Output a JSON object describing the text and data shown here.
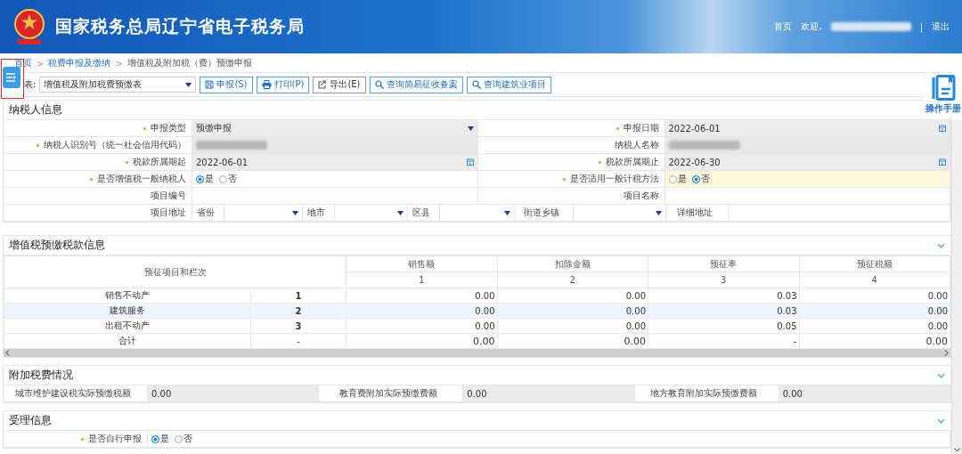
{
  "header": {
    "title": "国家税务总局辽宁省电子税务局",
    "home": "首页",
    "welcome": "欢迎,",
    "separator": "|",
    "logout": "退出"
  },
  "breadcrumb": {
    "separator": ">",
    "items": [
      {
        "label": "首页",
        "link": true
      },
      {
        "label": "税费申报及缴纳",
        "link": true
      },
      {
        "label": "增值税及附加税（费）预缴申报",
        "link": false
      }
    ]
  },
  "toolbar": {
    "report_label": "表:",
    "report_select": "增值税及附加税费预缴表",
    "buttons": [
      {
        "label": "申报(S)",
        "kind": "save"
      },
      {
        "label": "打印(P)",
        "kind": "print"
      },
      {
        "label": "导出(E)",
        "kind": "export"
      },
      {
        "label": "查询简易征收备案",
        "kind": "search"
      },
      {
        "label": "查询建筑业项目",
        "kind": "search"
      }
    ]
  },
  "help": {
    "label": "操作手册"
  },
  "taxpayer": {
    "title": "纳税人信息",
    "fields": [
      {
        "label": "申报类型",
        "required": true,
        "kind": "select",
        "value": "预缴申报"
      },
      {
        "label": "申报日期",
        "required": true,
        "kind": "date",
        "value": "2022-06-01"
      },
      {
        "label": "纳税人识别号（统一社会信用代码）",
        "required": true,
        "kind": "redacted"
      },
      {
        "label": "纳税人名称",
        "required": false,
        "kind": "redacted"
      },
      {
        "label": "税款所属期起",
        "required": true,
        "kind": "date",
        "value": "2022-06-01"
      },
      {
        "label": "税款所属期止",
        "required": true,
        "kind": "date",
        "value": "2022-06-30"
      },
      {
        "label": "是否增值税一般纳税人",
        "required": true,
        "kind": "radio",
        "highlighted": false,
        "options": [
          {
            "label": "是",
            "selected": true
          },
          {
            "label": "否",
            "selected": false
          }
        ]
      },
      {
        "label": "是否适用一般计税方法",
        "required": true,
        "kind": "radio",
        "highlighted": true,
        "options": [
          {
            "label": "是",
            "selected": false
          },
          {
            "label": "否",
            "selected": true
          }
        ]
      },
      {
        "label": "项目编号",
        "required": false,
        "kind": "text"
      },
      {
        "label": "项目名称",
        "required": false,
        "kind": "text"
      }
    ],
    "address": {
      "label": "项目地址",
      "parts": [
        {
          "label": "省份",
          "kind": "select"
        },
        {
          "label": "地市",
          "kind": "select"
        },
        {
          "label": "区县",
          "kind": "select"
        },
        {
          "label": "街道乡镇",
          "kind": "select"
        },
        {
          "label": "详细地址",
          "kind": "text"
        }
      ]
    }
  },
  "vat": {
    "title": "增值税预缴税款信息",
    "expanded": true,
    "corner": "预征项目和栏次",
    "columns": [
      {
        "label": "销售额",
        "index": "1"
      },
      {
        "label": "扣除金额",
        "index": "2"
      },
      {
        "label": "预征率",
        "index": "3"
      },
      {
        "label": "预征税额",
        "index": "4"
      }
    ],
    "rows": [
      {
        "label": "销售不动产",
        "index": "1",
        "kind": "item",
        "selected": false,
        "values": [
          "0.00",
          "0.00",
          "0.03",
          "0.00"
        ]
      },
      {
        "label": "建筑服务",
        "index": "2",
        "kind": "item",
        "selected": true,
        "values": [
          "0.00",
          "0.00",
          "0.03",
          "0.00"
        ]
      },
      {
        "label": "出租不动产",
        "index": "3",
        "kind": "item",
        "selected": false,
        "values": [
          "0.00",
          "0.00",
          "0.05",
          "0.00"
        ]
      },
      {
        "label": "合计",
        "index": "-",
        "kind": "total",
        "selected": false,
        "values": [
          "0.00",
          "0.00",
          "-",
          "0.00"
        ]
      }
    ]
  },
  "surcharge": {
    "title": "附加税费情况",
    "expanded": true,
    "fields": [
      {
        "label": "城市维护建设税实际预缴税额",
        "value": "0.00"
      },
      {
        "label": "教育费附加实际预缴费额",
        "value": "0.00"
      },
      {
        "label": "地方教育附加实际预缴费额",
        "value": "0.00"
      }
    ]
  },
  "acceptance": {
    "title": "受理信息",
    "expanded": true,
    "self_filing": {
      "label": "是否自行申报",
      "required": true,
      "options": [
        {
          "label": "是",
          "selected": true
        },
        {
          "label": "否",
          "selected": false
        }
      ]
    }
  }
}
